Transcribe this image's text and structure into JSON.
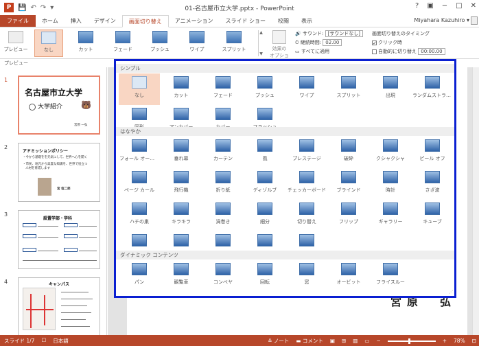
{
  "window": {
    "doc_title": "01-名古屋市立大学.pptx - PowerPoint",
    "logo": "P",
    "qat": [
      "💾",
      "↶",
      "↷",
      "▾"
    ],
    "controls": [
      "?",
      "▣",
      "−",
      "□",
      "✕"
    ],
    "user": "Miyahara Kazuhiro ▾"
  },
  "tabs": [
    {
      "label": "ファイル"
    },
    {
      "label": "ホーム"
    },
    {
      "label": "挿入"
    },
    {
      "label": "デザイン"
    },
    {
      "label": "画面切り替え"
    },
    {
      "label": "アニメーション"
    },
    {
      "label": "スライド ショー"
    },
    {
      "label": "校閲"
    },
    {
      "label": "表示"
    }
  ],
  "ribbon": {
    "preview_label": "プレビュー",
    "transitions": [
      "なし",
      "カット",
      "フェード",
      "プッシュ",
      "ワイプ",
      "スプリット"
    ],
    "scroll_up": "▲",
    "scroll_down": "▼",
    "effect_label": "効果の\nオプション▾",
    "sound_label": "サウンド:",
    "sound_value": "[サウンドなし]",
    "duration_label": "継続時間:",
    "duration_value": "02.00",
    "apply_all": "すべてに適用",
    "timing_title": "画面切り替えのタイミング",
    "on_click": "クリック時",
    "auto_after": "自動的に切り替え",
    "auto_value": "00:00.00",
    "group_preview": "プレビュー"
  },
  "slides": [
    {
      "num": "1",
      "title": "名古屋市立大学",
      "subtitle": "大学紹介",
      "footer": "宮原 一弘"
    },
    {
      "num": "2",
      "heading": "アドミッションポリシー",
      "bullets": [
        "・今から基礎をを元気にして、世界へ心を開く",
        "・市民、地元から高度な知識を、世界で役立つ",
        "人材を育成します"
      ],
      "name": "宮 信二郎"
    },
    {
      "num": "3",
      "heading": "設置学部・学科"
    },
    {
      "num": "4",
      "heading": "キャンパス"
    }
  ],
  "slide_main_text": "宮原　弘",
  "gallery": {
    "sections": [
      {
        "title": "シンプル",
        "items": [
          "なし",
          "カット",
          "フェード",
          "プッシュ",
          "ワイプ",
          "スプリット",
          "出現",
          "ランダムストライプ",
          "図形",
          "アンカバー",
          "カバー",
          "フラッシュ"
        ]
      },
      {
        "title": "はなやか",
        "items": [
          "フォール オーバー",
          "垂れ幕",
          "カーテン",
          "風",
          "プレステージ",
          "破砕",
          "クシャクシャ",
          "ピール オフ",
          "ページ カール",
          "飛行機",
          "折り紙",
          "ディゾルブ",
          "チェッカーボード",
          "ブラインド",
          "時計",
          "さざ波",
          "ハチの巣",
          "キラキラ",
          "渦巻き",
          "細分",
          "切り替え",
          "フリップ",
          "ギャラリー",
          "キューブ",
          "扉",
          "ボックス",
          "コーム",
          "ズーム",
          "ランダム"
        ]
      },
      {
        "title": "ダイナミック コンテンツ",
        "items": [
          "パン",
          "観覧車",
          "コンベヤ",
          "回転",
          "窓",
          "オービット",
          "フライスルー"
        ]
      }
    ],
    "resize_glyph": "⋰"
  },
  "status": {
    "slide": "スライド 1/7",
    "lang": "日本語",
    "notes": "ノート",
    "comments": "コメント",
    "zoom": "78%"
  }
}
